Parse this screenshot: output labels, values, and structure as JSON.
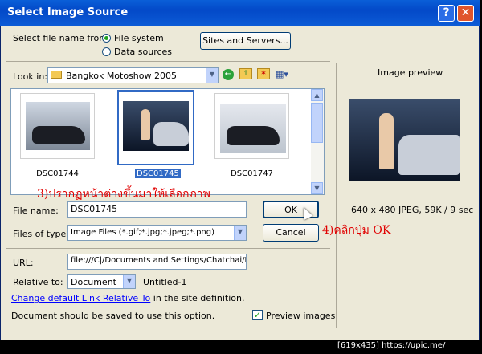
{
  "window": {
    "title": "Select Image Source",
    "help_label": "?",
    "close_label": "✕"
  },
  "source": {
    "label": "Select file name from:",
    "options": [
      {
        "label": "File system",
        "selected": true
      },
      {
        "label": "Data sources",
        "selected": false
      }
    ],
    "sites_button": "Sites and Servers..."
  },
  "look_in": {
    "label": "Look in:",
    "value": "Bangkok Motoshow 2005"
  },
  "toolbar_icons": [
    "back-icon",
    "up-folder-icon",
    "new-folder-icon",
    "view-menu-icon"
  ],
  "files": [
    {
      "name": "DSC01744",
      "selected": false
    },
    {
      "name": "DSC01745",
      "selected": true
    },
    {
      "name": "DSC01747",
      "selected": false
    }
  ],
  "annotations": {
    "step3": "3)ปรากฏหน้าต่างขึ้นมาให้เลือกภาพ",
    "step4": "4)คลิกปุ่ม OK"
  },
  "file_name": {
    "label": "File name:",
    "value": "DSC01745"
  },
  "files_of_type": {
    "label": "Files of type:",
    "value": "Image Files (*.gif;*.jpg;*.jpeg;*.png)"
  },
  "buttons": {
    "ok": "OK",
    "cancel": "Cancel"
  },
  "url": {
    "label": "URL:",
    "value": "file:///C|/Documents and Settings/Chatchai/My"
  },
  "relative_to": {
    "label": "Relative to:",
    "value": "Document",
    "doc": "Untitled-1"
  },
  "link": {
    "text": "Change default Link Relative To",
    "suffix": " in the site definition."
  },
  "note": "Document should be saved to use this option.",
  "preview": {
    "title": "Image preview",
    "info": "640 x 480 JPEG, 59K / 9 sec",
    "checkbox_label": "Preview images",
    "checked": true
  },
  "watermark": "[619x435] https://upic.me/"
}
